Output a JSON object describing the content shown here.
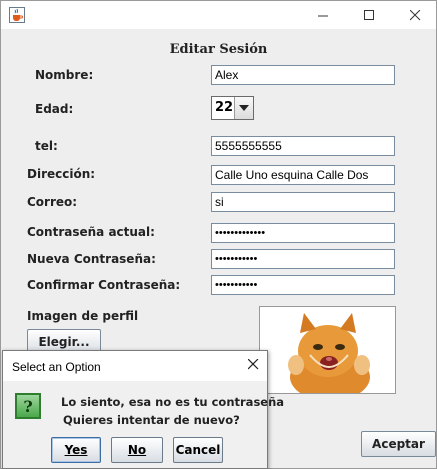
{
  "window": {
    "title": "",
    "controls": {
      "minimize": "minimize",
      "maximize": "maximize",
      "close": "close"
    }
  },
  "form": {
    "heading": "Editar Sesión",
    "nombre": {
      "label": "Nombre:",
      "value": "Alex"
    },
    "edad": {
      "label": "Edad:",
      "value": "22"
    },
    "tel": {
      "label": "tel:",
      "value": "5555555555"
    },
    "direccion": {
      "label": "Dirección:",
      "value": "Calle Uno esquina Calle Dos"
    },
    "correo": {
      "label": "Correo:",
      "value": "si"
    },
    "contrasena_actual": {
      "label": "Contraseña actual:",
      "value": "•••••••••••••"
    },
    "nueva_contrasena": {
      "label": "Nueva Contraseña:",
      "value": "•••••••••••"
    },
    "confirmar_contrasena": {
      "label": "Confirmar Contraseña:",
      "value": "•••••••••••"
    },
    "imagen_label": "Imagen de perfil",
    "elegir_button": "Elegir...",
    "aceptar_button": "Aceptar"
  },
  "dialog": {
    "title": "Select an Option",
    "line1": "Lo siento, esa no es tu contraseña",
    "line2": "Quieres intentar de nuevo?",
    "yes": "Yes",
    "no": "No",
    "cancel": "Cancel"
  },
  "icons": {
    "app": "java-cup-icon",
    "question": "question-icon",
    "dropdown": "chevron-down-icon"
  }
}
